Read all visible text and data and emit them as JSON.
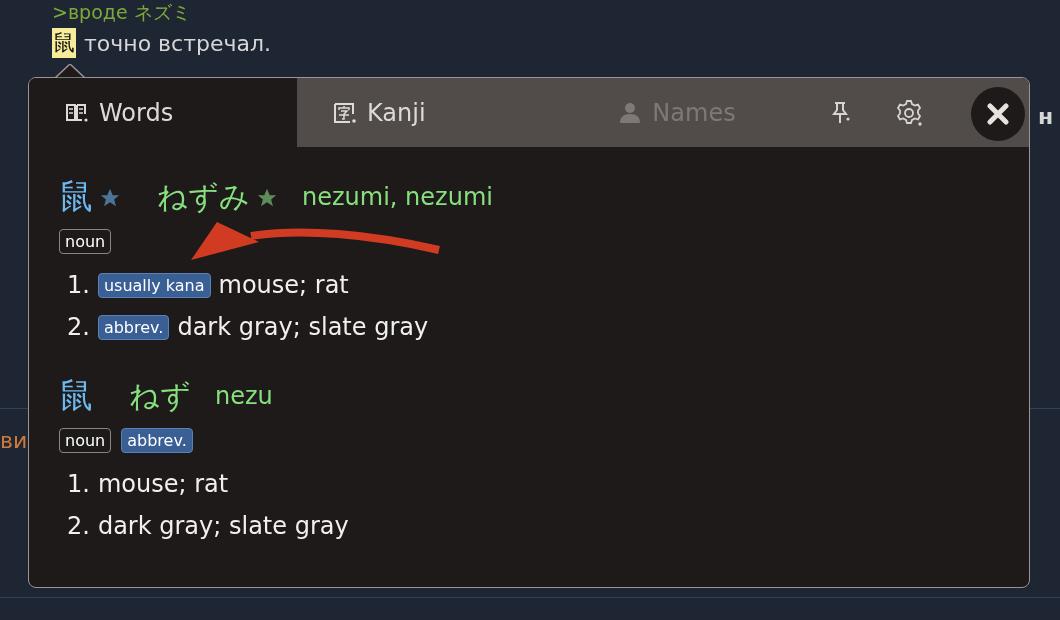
{
  "page": {
    "lines": [
      {
        "kind": "quote",
        "text": ">вроде ネズミ"
      },
      {
        "kind": "plain",
        "highlight": "鼠",
        "text": "точно встречал."
      }
    ],
    "left_fragment": "ви",
    "right_fragment": "н"
  },
  "popup": {
    "tabs": [
      {
        "label": "Words",
        "selected": true,
        "disabled": false
      },
      {
        "label": "Kanji",
        "selected": false,
        "disabled": false
      },
      {
        "label": "Names",
        "selected": false,
        "disabled": true
      }
    ],
    "entries": [
      {
        "kanji": "鼠",
        "kanji_starred": true,
        "reading": "ねずみ",
        "reading_starred": true,
        "romaji": "nezumi, nezumi",
        "tags": [
          {
            "kind": "pos",
            "label": "noun"
          }
        ],
        "senses": [
          {
            "number": "1.",
            "tags": [
              {
                "kind": "misc",
                "label": "usually kana"
              }
            ],
            "text": "mouse; rat"
          },
          {
            "number": "2.",
            "tags": [
              {
                "kind": "misc",
                "label": "abbrev."
              }
            ],
            "text": "dark gray; slate gray"
          }
        ]
      },
      {
        "kanji": "鼠",
        "kanji_starred": false,
        "reading": "ねず",
        "reading_starred": false,
        "romaji": "nezu",
        "tags": [
          {
            "kind": "pos",
            "label": "noun"
          },
          {
            "kind": "misc",
            "label": "abbrev."
          }
        ],
        "senses": [
          {
            "number": "1.",
            "text": "mouse; rat"
          },
          {
            "number": "2.",
            "text": "dark gray; slate gray"
          }
        ]
      }
    ]
  }
}
